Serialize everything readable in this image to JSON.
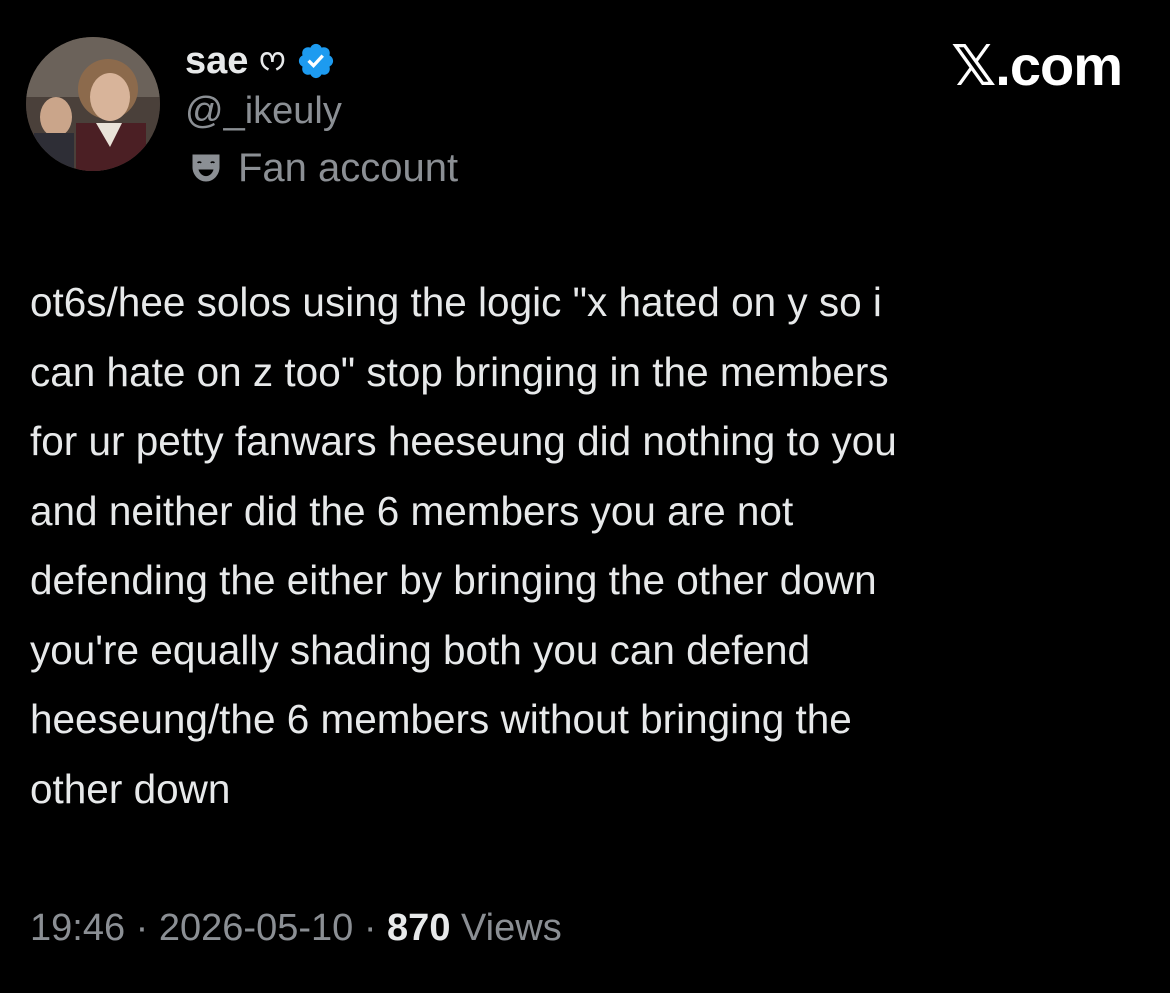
{
  "author": {
    "display_name": "sae",
    "name_emoji": "ᰔ",
    "handle": "@_ikeuly",
    "verified": true,
    "label": "Fan account",
    "avatar": "profile-photo"
  },
  "brand": "𝕏.com",
  "tweet": {
    "lines": [
      "ot6s/hee solos using the logic \"x hated on y so i",
      "can hate on z too\" stop bringing in the members",
      "for ur petty fanwars heeseung did nothing to you",
      "and neither did the 6 members you are not",
      "defending the either by bringing the other down",
      "you're equally shading both you can defend",
      "heeseung/the 6 members without bringing the",
      "other down"
    ]
  },
  "meta": {
    "time": "19:46",
    "separator": "·",
    "date": "2026-05-10",
    "views_count": "870",
    "views_label": "Views"
  },
  "colors": {
    "background": "#000000",
    "text": "#e7e9ea",
    "secondary": "#8b8f94",
    "verified": "#1d9bf0"
  }
}
